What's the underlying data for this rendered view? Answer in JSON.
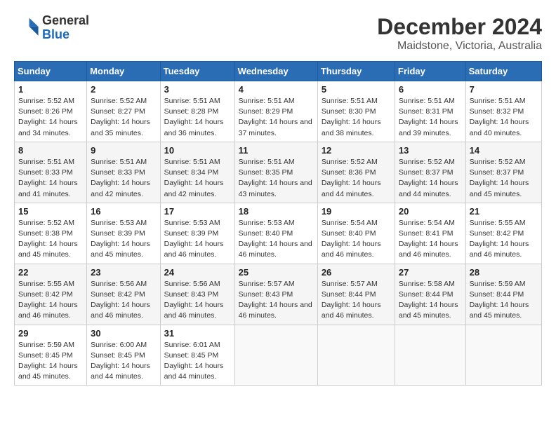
{
  "logo": {
    "line1": "General",
    "line2": "Blue"
  },
  "title": "December 2024",
  "location": "Maidstone, Victoria, Australia",
  "days_of_week": [
    "Sunday",
    "Monday",
    "Tuesday",
    "Wednesday",
    "Thursday",
    "Friday",
    "Saturday"
  ],
  "weeks": [
    [
      {
        "day": "1",
        "sunrise": "5:52 AM",
        "sunset": "8:26 PM",
        "daylight": "14 hours and 34 minutes."
      },
      {
        "day": "2",
        "sunrise": "5:52 AM",
        "sunset": "8:27 PM",
        "daylight": "14 hours and 35 minutes."
      },
      {
        "day": "3",
        "sunrise": "5:51 AM",
        "sunset": "8:28 PM",
        "daylight": "14 hours and 36 minutes."
      },
      {
        "day": "4",
        "sunrise": "5:51 AM",
        "sunset": "8:29 PM",
        "daylight": "14 hours and 37 minutes."
      },
      {
        "day": "5",
        "sunrise": "5:51 AM",
        "sunset": "8:30 PM",
        "daylight": "14 hours and 38 minutes."
      },
      {
        "day": "6",
        "sunrise": "5:51 AM",
        "sunset": "8:31 PM",
        "daylight": "14 hours and 39 minutes."
      },
      {
        "day": "7",
        "sunrise": "5:51 AM",
        "sunset": "8:32 PM",
        "daylight": "14 hours and 40 minutes."
      }
    ],
    [
      {
        "day": "8",
        "sunrise": "5:51 AM",
        "sunset": "8:33 PM",
        "daylight": "14 hours and 41 minutes."
      },
      {
        "day": "9",
        "sunrise": "5:51 AM",
        "sunset": "8:33 PM",
        "daylight": "14 hours and 42 minutes."
      },
      {
        "day": "10",
        "sunrise": "5:51 AM",
        "sunset": "8:34 PM",
        "daylight": "14 hours and 42 minutes."
      },
      {
        "day": "11",
        "sunrise": "5:51 AM",
        "sunset": "8:35 PM",
        "daylight": "14 hours and 43 minutes."
      },
      {
        "day": "12",
        "sunrise": "5:52 AM",
        "sunset": "8:36 PM",
        "daylight": "14 hours and 44 minutes."
      },
      {
        "day": "13",
        "sunrise": "5:52 AM",
        "sunset": "8:37 PM",
        "daylight": "14 hours and 44 minutes."
      },
      {
        "day": "14",
        "sunrise": "5:52 AM",
        "sunset": "8:37 PM",
        "daylight": "14 hours and 45 minutes."
      }
    ],
    [
      {
        "day": "15",
        "sunrise": "5:52 AM",
        "sunset": "8:38 PM",
        "daylight": "14 hours and 45 minutes."
      },
      {
        "day": "16",
        "sunrise": "5:53 AM",
        "sunset": "8:39 PM",
        "daylight": "14 hours and 45 minutes."
      },
      {
        "day": "17",
        "sunrise": "5:53 AM",
        "sunset": "8:39 PM",
        "daylight": "14 hours and 46 minutes."
      },
      {
        "day": "18",
        "sunrise": "5:53 AM",
        "sunset": "8:40 PM",
        "daylight": "14 hours and 46 minutes."
      },
      {
        "day": "19",
        "sunrise": "5:54 AM",
        "sunset": "8:40 PM",
        "daylight": "14 hours and 46 minutes."
      },
      {
        "day": "20",
        "sunrise": "5:54 AM",
        "sunset": "8:41 PM",
        "daylight": "14 hours and 46 minutes."
      },
      {
        "day": "21",
        "sunrise": "5:55 AM",
        "sunset": "8:42 PM",
        "daylight": "14 hours and 46 minutes."
      }
    ],
    [
      {
        "day": "22",
        "sunrise": "5:55 AM",
        "sunset": "8:42 PM",
        "daylight": "14 hours and 46 minutes."
      },
      {
        "day": "23",
        "sunrise": "5:56 AM",
        "sunset": "8:42 PM",
        "daylight": "14 hours and 46 minutes."
      },
      {
        "day": "24",
        "sunrise": "5:56 AM",
        "sunset": "8:43 PM",
        "daylight": "14 hours and 46 minutes."
      },
      {
        "day": "25",
        "sunrise": "5:57 AM",
        "sunset": "8:43 PM",
        "daylight": "14 hours and 46 minutes."
      },
      {
        "day": "26",
        "sunrise": "5:57 AM",
        "sunset": "8:44 PM",
        "daylight": "14 hours and 46 minutes."
      },
      {
        "day": "27",
        "sunrise": "5:58 AM",
        "sunset": "8:44 PM",
        "daylight": "14 hours and 45 minutes."
      },
      {
        "day": "28",
        "sunrise": "5:59 AM",
        "sunset": "8:44 PM",
        "daylight": "14 hours and 45 minutes."
      }
    ],
    [
      {
        "day": "29",
        "sunrise": "5:59 AM",
        "sunset": "8:45 PM",
        "daylight": "14 hours and 45 minutes."
      },
      {
        "day": "30",
        "sunrise": "6:00 AM",
        "sunset": "8:45 PM",
        "daylight": "14 hours and 44 minutes."
      },
      {
        "day": "31",
        "sunrise": "6:01 AM",
        "sunset": "8:45 PM",
        "daylight": "14 hours and 44 minutes."
      },
      null,
      null,
      null,
      null
    ]
  ]
}
